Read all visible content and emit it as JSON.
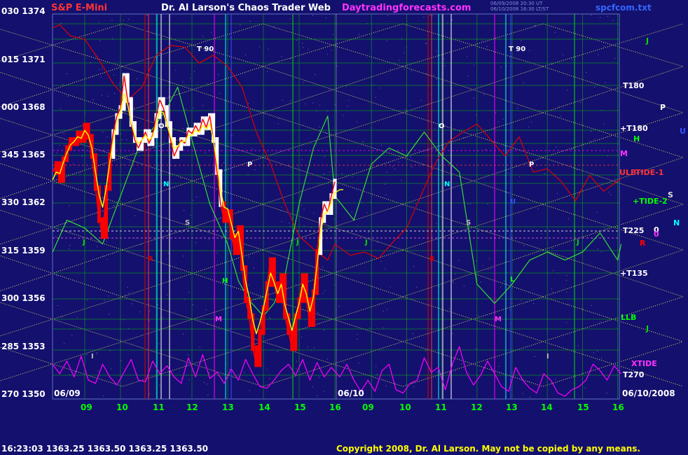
{
  "header": {
    "symbol": "S&P E-Mini",
    "title": "Dr. Al Larson's Chaos Trader Web",
    "site": "Daytradingforecasts.com",
    "file": "spcfcom.txt",
    "stamp_line1": "06/09/2008 20:30 UT",
    "stamp_line2": "06/10/2008 16:30 LT/ST"
  },
  "footer": {
    "quote": "16:23:03  1363.25  1363.50  1363.25  1363.50",
    "copyright": "Copyright 2008, Dr. Al Larson. May not be copied by any means."
  },
  "colors": {
    "background": "#14106e",
    "price": "#ff0000",
    "price_white": "#ffffff",
    "ribbon": "#ffff00",
    "green": "#00dd00",
    "magenta": "#ff00ff",
    "red_line": "#dd0000",
    "grid": "#00cc00",
    "diag": "#ffff66",
    "cyan": "#00ffff"
  },
  "chart_data": {
    "type": "line",
    "title": "S&P E-Mini",
    "y_tick_labels": [
      "030 1374",
      "015 1371",
      "000 1368",
      "345 1365",
      "330 1362",
      "315 1359",
      "300 1356",
      "285 1353",
      "270 1350"
    ],
    "y_ticks": [
      1374,
      1371,
      1368,
      1365,
      1362,
      1359,
      1356,
      1353,
      1350
    ],
    "ylim": [
      1350,
      1374.6
    ],
    "x_tick_labels": [
      "09",
      "10",
      "11",
      "12",
      "13",
      "14",
      "15",
      "16",
      "09",
      "10",
      "11",
      "12",
      "13",
      "14",
      "15",
      "16"
    ],
    "xlim": [
      8.1,
      24.1
    ],
    "date_labels": [
      "06/09",
      "06/10",
      "06/10/2008"
    ],
    "price_series": {
      "name": "S&P E-Mini",
      "x": [
        8.1,
        8.2,
        8.3,
        8.4,
        8.5,
        8.6,
        8.7,
        8.8,
        8.9,
        9.0,
        9.1,
        9.2,
        9.3,
        9.4,
        9.5,
        9.6,
        9.7,
        9.8,
        9.9,
        10.0,
        10.1,
        10.2,
        10.3,
        10.4,
        10.5,
        10.6,
        10.7,
        10.8,
        10.9,
        11.0,
        11.1,
        11.2,
        11.3,
        11.4,
        11.5,
        11.6,
        11.7,
        11.8,
        11.9,
        12.0,
        12.1,
        12.2,
        12.3,
        12.4,
        12.5,
        12.6,
        12.7,
        12.8,
        12.9,
        13.0,
        13.1,
        13.2,
        13.3,
        13.4,
        13.5,
        13.6,
        13.7,
        13.8,
        13.9,
        14.0,
        14.1,
        14.2,
        14.3,
        14.4,
        14.5,
        14.6,
        14.7,
        14.8,
        14.9,
        15.0,
        15.1,
        15.2,
        15.3,
        15.4,
        15.5,
        15.6,
        15.7,
        15.8,
        15.9,
        16.0
      ],
      "y": [
        1364.0,
        1364.5,
        1363.5,
        1364.8,
        1365.5,
        1366.0,
        1365.8,
        1366.4,
        1366.0,
        1366.9,
        1366.2,
        1365.0,
        1363.0,
        1361.0,
        1360.0,
        1363.0,
        1365.0,
        1366.5,
        1367.5,
        1368.0,
        1370.0,
        1368.5,
        1367.0,
        1366.0,
        1365.5,
        1366.0,
        1366.5,
        1365.8,
        1366.3,
        1367.5,
        1368.5,
        1368.0,
        1367.0,
        1366.0,
        1365.0,
        1365.5,
        1366.0,
        1365.8,
        1366.6,
        1366.4,
        1366.9,
        1366.5,
        1367.3,
        1366.8,
        1367.5,
        1366.0,
        1364.0,
        1362.0,
        1361.0,
        1361.5,
        1360.0,
        1359.0,
        1360.5,
        1358.0,
        1356.0,
        1355.0,
        1353.0,
        1352.0,
        1354.0,
        1355.5,
        1357.0,
        1358.5,
        1357.0,
        1356.0,
        1357.5,
        1355.0,
        1354.0,
        1353.0,
        1355.0,
        1356.0,
        1357.5,
        1356.0,
        1354.5,
        1356.5,
        1359.0,
        1361.0,
        1362.0,
        1361.5,
        1362.5,
        1363.4
      ]
    },
    "ribbon_series": {
      "name": "ribbon",
      "x": [
        8.1,
        8.2,
        8.3,
        8.4,
        8.5,
        8.6,
        8.7,
        8.8,
        8.9,
        9.0,
        9.1,
        9.2,
        9.3,
        9.4,
        9.5,
        9.6,
        9.7,
        9.8,
        9.9,
        10.0,
        10.1,
        10.2,
        10.3,
        10.4,
        10.5,
        10.6,
        10.7,
        10.8,
        10.9,
        11.0,
        11.1,
        11.2,
        11.3,
        11.4,
        11.5,
        11.6,
        11.7,
        11.8,
        11.9,
        12.0,
        12.1,
        12.2,
        12.3,
        12.4,
        12.5,
        12.6,
        12.7,
        12.8,
        12.9,
        13.0,
        13.1,
        13.2,
        13.3,
        13.4,
        13.5,
        13.6,
        13.7,
        13.8,
        13.9,
        14.0,
        14.1,
        14.2,
        14.3,
        14.4,
        14.5,
        14.6,
        14.7,
        14.8,
        14.9,
        15.0,
        15.1,
        15.2,
        15.3,
        15.4,
        15.5,
        15.6,
        15.7,
        15.8,
        15.9,
        16.0,
        16.1,
        16.2
      ],
      "y": [
        1363.5,
        1364.0,
        1363.9,
        1364.6,
        1365.2,
        1365.7,
        1365.9,
        1366.2,
        1366.1,
        1366.6,
        1366.3,
        1365.5,
        1364.0,
        1362.6,
        1361.8,
        1363.0,
        1364.6,
        1366.0,
        1367.0,
        1367.8,
        1368.9,
        1368.2,
        1367.1,
        1366.3,
        1365.8,
        1366.0,
        1366.3,
        1366.0,
        1366.2,
        1367.0,
        1367.8,
        1367.7,
        1367.0,
        1366.2,
        1365.5,
        1365.6,
        1365.9,
        1365.9,
        1366.3,
        1366.3,
        1366.6,
        1366.5,
        1366.9,
        1366.7,
        1367.0,
        1366.0,
        1364.5,
        1362.9,
        1361.8,
        1361.7,
        1360.8,
        1359.9,
        1360.3,
        1358.8,
        1357.2,
        1356.2,
        1354.8,
        1353.9,
        1354.6,
        1355.5,
        1356.6,
        1357.7,
        1357.1,
        1356.4,
        1357.0,
        1355.7,
        1354.9,
        1354.1,
        1355.0,
        1355.8,
        1357.0,
        1356.4,
        1355.3,
        1356.2,
        1358.2,
        1360.2,
        1361.4,
        1361.5,
        1362.1,
        1362.7,
        1362.9,
        1362.9
      ]
    },
    "green_series": {
      "name": "green",
      "x": [
        8.1,
        8.5,
        9.0,
        9.5,
        10.0,
        10.5,
        11.0,
        11.3,
        11.6,
        12.0,
        12.5,
        13.0,
        13.3,
        13.6,
        14.0,
        14.3,
        14.6,
        15.0,
        15.4,
        15.8,
        16.0,
        16.5,
        17.0,
        17.5,
        18.0,
        18.5,
        19.0,
        19.5,
        20.0,
        20.5,
        21.0,
        21.5,
        22.0,
        22.5,
        23.0,
        23.5,
        24.0,
        24.1
      ],
      "y": [
        1359.0,
        1361.0,
        1360.5,
        1359.5,
        1362.5,
        1365.5,
        1367.0,
        1368.0,
        1369.3,
        1366.0,
        1362.0,
        1359.5,
        1357.2,
        1356.0,
        1355.0,
        1355.8,
        1357.5,
        1362.0,
        1365.5,
        1367.5,
        1362.5,
        1361.0,
        1364.5,
        1365.5,
        1365.0,
        1366.5,
        1365.0,
        1364.0,
        1357.0,
        1355.8,
        1357.0,
        1358.5,
        1359.0,
        1358.5,
        1359.0,
        1360.2,
        1358.5,
        1359.5
      ]
    },
    "magenta_series": {
      "name": "XTIDE",
      "x": [
        8.1,
        8.3,
        8.5,
        8.7,
        8.9,
        9.1,
        9.3,
        9.5,
        9.7,
        9.9,
        10.1,
        10.3,
        10.5,
        10.7,
        10.9,
        11.1,
        11.3,
        11.5,
        11.7,
        11.9,
        12.1,
        12.3,
        12.5,
        12.7,
        12.9,
        13.1,
        13.3,
        13.5,
        13.7,
        13.9,
        14.1,
        14.3,
        14.5,
        14.7,
        14.9,
        15.1,
        15.3,
        15.5,
        15.7,
        15.9,
        16.1,
        16.3,
        16.5,
        16.7,
        16.9,
        17.1,
        17.3,
        17.5,
        17.7,
        17.9,
        18.1,
        18.3,
        18.5,
        18.7,
        18.9,
        19.1,
        19.3,
        19.5,
        19.7,
        19.9,
        20.1,
        20.3,
        20.5,
        20.7,
        20.9,
        21.1,
        21.3,
        21.5,
        21.7,
        21.9,
        22.1,
        22.3,
        22.5,
        22.7,
        22.9,
        23.1,
        23.3,
        23.5,
        23.7,
        23.9,
        24.1
      ],
      "y": [
        1352.0,
        1351.4,
        1352.2,
        1351.2,
        1352.5,
        1351.0,
        1350.8,
        1352.0,
        1351.2,
        1350.7,
        1351.5,
        1352.3,
        1351.0,
        1350.9,
        1352.2,
        1351.4,
        1351.9,
        1351.2,
        1350.8,
        1352.4,
        1351.2,
        1352.6,
        1351.1,
        1351.5,
        1350.8,
        1351.7,
        1351.0,
        1352.3,
        1351.4,
        1350.6,
        1350.5,
        1351.0,
        1351.6,
        1352.0,
        1351.3,
        1352.3,
        1351.0,
        1352.1,
        1351.2,
        1351.8,
        1351.2,
        1352.0,
        1351.0,
        1350.3,
        1351.0,
        1350.3,
        1351.6,
        1352.0,
        1350.4,
        1350.2,
        1350.8,
        1351.0,
        1352.4,
        1351.5,
        1351.8,
        1350.4,
        1352.0,
        1353.1,
        1351.5,
        1350.7,
        1351.3,
        1352.2,
        1351.4,
        1350.6,
        1350.3,
        1351.8,
        1351.0,
        1350.5,
        1350.2,
        1351.4,
        1351.0,
        1350.2,
        1350.0,
        1350.4,
        1350.6,
        1351.0,
        1352.0,
        1351.6,
        1351.0,
        1351.9,
        1351.4
      ]
    },
    "red_series": {
      "name": "ULB",
      "x": [
        8.1,
        8.3,
        8.6,
        9.0,
        9.4,
        9.8,
        10.2,
        10.6,
        11.0,
        11.4,
        11.8,
        12.2,
        12.6,
        13.0,
        13.4,
        13.8,
        14.2,
        14.6,
        15.0,
        15.4,
        15.8,
        16.0,
        16.4,
        16.8,
        17.2,
        17.6,
        18.0,
        18.4,
        18.8,
        19.2,
        19.6,
        20.0,
        20.4,
        20.8,
        21.2,
        21.6,
        22.0,
        22.4,
        22.8,
        23.2,
        23.6,
        24.1
      ],
      "y": [
        1373.0,
        1373.2,
        1372.5,
        1372.3,
        1371.0,
        1369.5,
        1368.5,
        1369.3,
        1371.3,
        1371.9,
        1371.8,
        1370.8,
        1371.3,
        1370.6,
        1369.3,
        1366.5,
        1364.5,
        1362.0,
        1360.0,
        1359.2,
        1358.5,
        1359.5,
        1358.8,
        1359.0,
        1358.6,
        1359.6,
        1360.5,
        1362.5,
        1364.5,
        1365.9,
        1366.5,
        1367.0,
        1366.0,
        1365.0,
        1366.2,
        1364.0,
        1364.2,
        1363.4,
        1362.2,
        1363.8,
        1362.8,
        1363.6
      ]
    },
    "right_labels": [
      "T180",
      "+T180",
      "H",
      "M",
      "ULB",
      "TIDE-1",
      "+TIDE-2",
      "T225",
      "R",
      "+T135",
      "LLB",
      "J",
      "XTIDE",
      "T270",
      "J",
      "P",
      "U",
      "S",
      "N",
      "0",
      "0"
    ],
    "planet_labels": [
      "T 90",
      "T 90",
      "O",
      "O",
      "P",
      "P",
      "N",
      "N",
      "S",
      "S",
      "J",
      "J",
      "J",
      "J",
      "H",
      "M",
      "M",
      "U",
      "L",
      "I",
      "I",
      "R",
      "R"
    ]
  }
}
